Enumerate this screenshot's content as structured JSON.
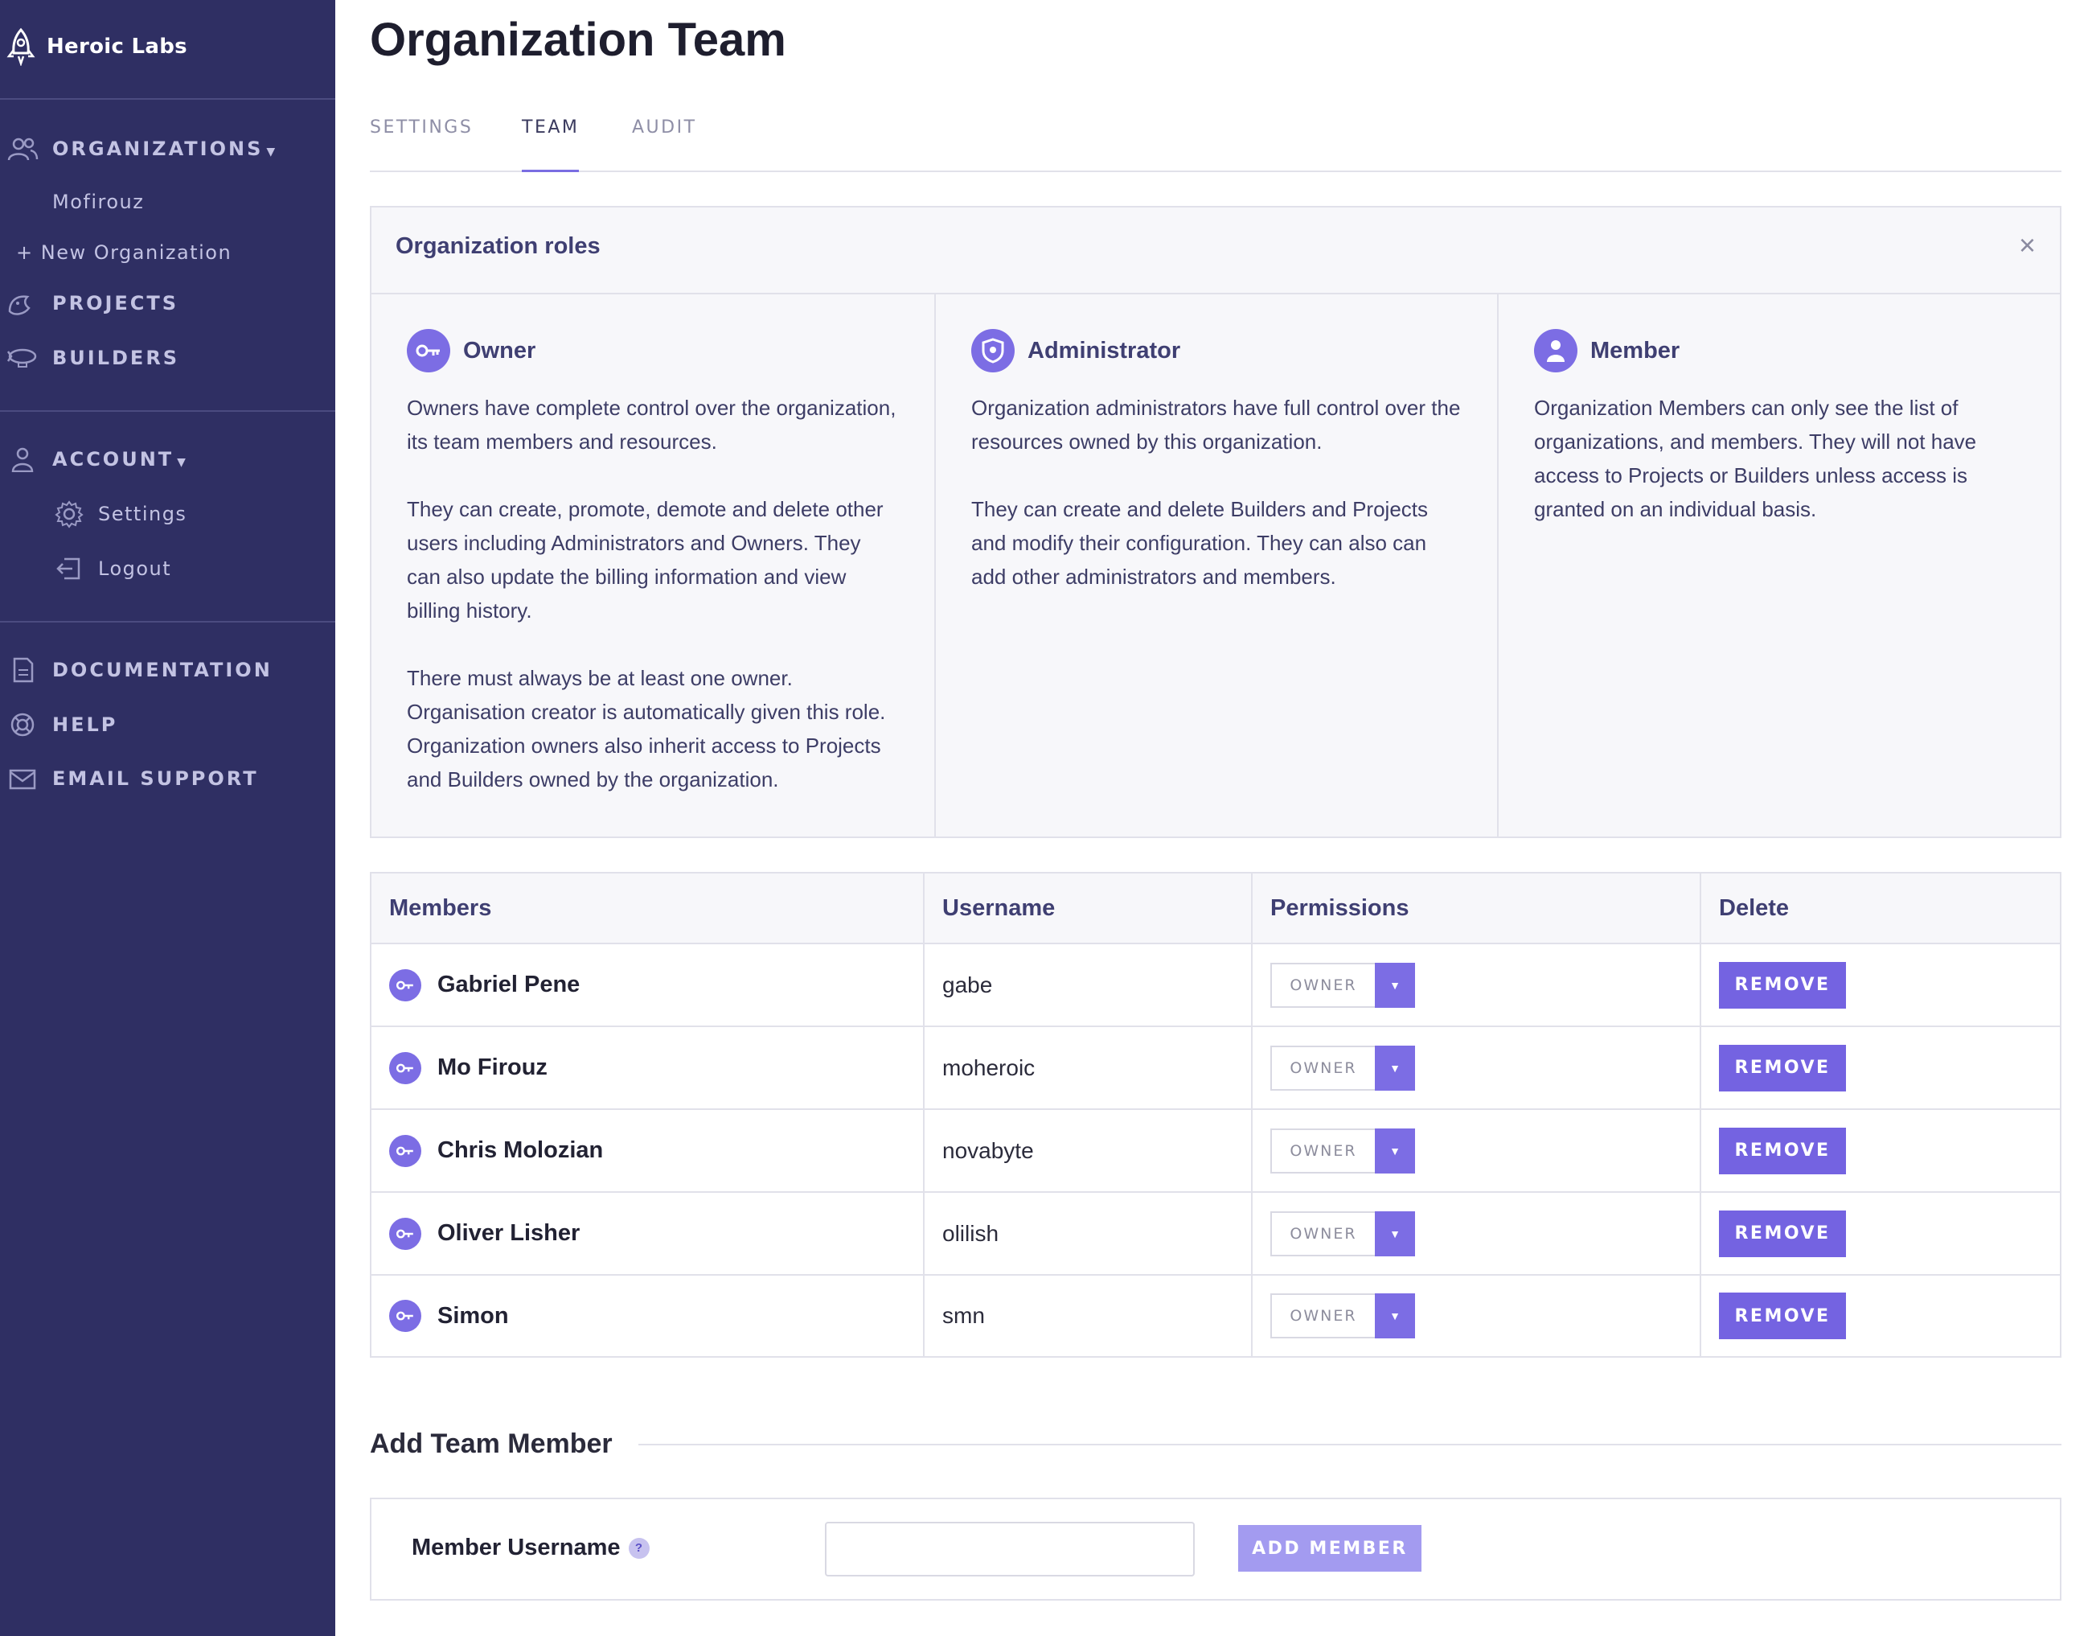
{
  "sidebar": {
    "brand": "Heroic Labs",
    "organizations": {
      "label": "ORGANIZATIONS",
      "items": [
        "Mofirouz"
      ],
      "new_org": "+ New Organization"
    },
    "projects": "PROJECTS",
    "builders": "BUILDERS",
    "account": {
      "label": "ACCOUNT",
      "settings": "Settings",
      "logout": "Logout"
    },
    "documentation": "DOCUMENTATION",
    "help": "HELP",
    "email_support": "EMAIL SUPPORT"
  },
  "page": {
    "title": "Organization Team",
    "tabs": [
      {
        "label": "SETTINGS",
        "active": false
      },
      {
        "label": "TEAM",
        "active": true
      },
      {
        "label": "AUDIT",
        "active": false
      }
    ]
  },
  "roles": {
    "title": "Organization roles",
    "close": "×",
    "items": [
      {
        "name": "Owner",
        "icon": "key-icon",
        "paragraphs": [
          "Owners have complete control over the organization, its team members and resources.",
          "They can create, promote, demote and delete other users including Administrators and Owners. They can also update the billing information and view billing history.",
          "There must always be at least one owner. Organisation creator is automatically given this role. Organization owners also inherit access to Projects and Builders owned by the organization."
        ]
      },
      {
        "name": "Administrator",
        "icon": "shield-icon",
        "paragraphs": [
          "Organization administrators have full control over the resources owned by this organization.",
          "They can create and delete Builders and Projects and modify their configuration. They can also can add other administrators and members."
        ]
      },
      {
        "name": "Member",
        "icon": "user-icon",
        "paragraphs": [
          "Organization Members can only see the list of organizations, and members. They will not have access to Projects or Builders unless access is granted on an individual basis."
        ]
      }
    ]
  },
  "members_table": {
    "headers": [
      "Members",
      "Username",
      "Permissions",
      "Delete"
    ],
    "remove_label": "REMOVE",
    "rows": [
      {
        "name": "Gabriel Pene",
        "username": "gabe",
        "permission": "OWNER"
      },
      {
        "name": "Mo Firouz",
        "username": "moheroic",
        "permission": "OWNER"
      },
      {
        "name": "Chris Molozian",
        "username": "novabyte",
        "permission": "OWNER"
      },
      {
        "name": "Oliver Lisher",
        "username": "olilish",
        "permission": "OWNER"
      },
      {
        "name": "Simon",
        "username": "smn",
        "permission": "OWNER"
      }
    ]
  },
  "add_member": {
    "title": "Add Team Member",
    "label": "Member Username",
    "help": "?",
    "input_value": "",
    "button": "ADD MEMBER"
  },
  "colors": {
    "sidebar_bg": "#2f2f63",
    "accent": "#7463e1",
    "accent_disabled": "#a39bf0"
  }
}
